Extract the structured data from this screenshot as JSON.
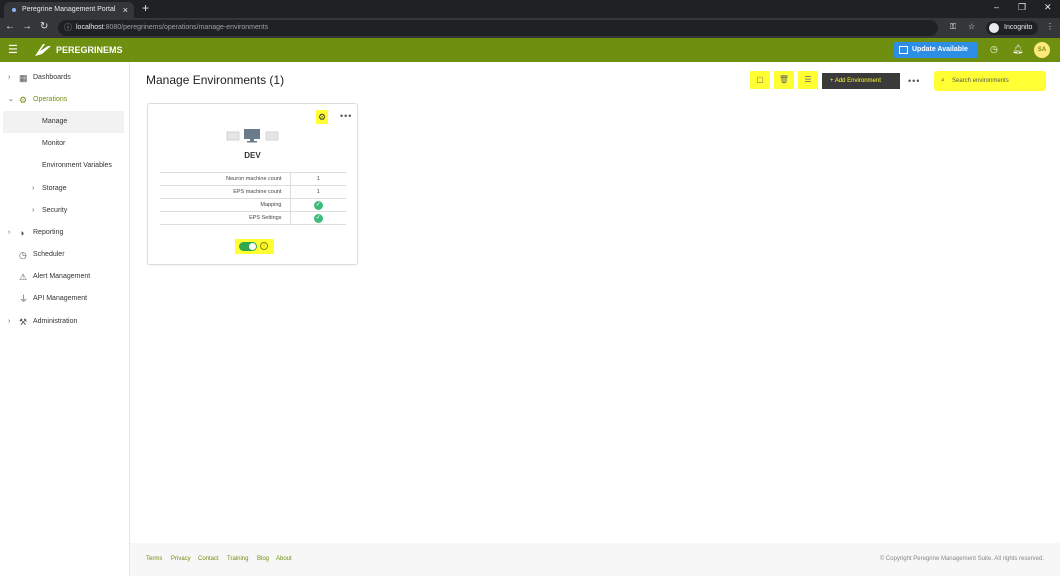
{
  "browser": {
    "tab_title": "Peregrine Management Portal",
    "tab_close": "×",
    "new_tab": "+",
    "url_host": "localhost",
    "url_rest": ":8080/peregrinems/operations/manage-environments",
    "incognito_label": "Incognito",
    "window_controls": [
      "–",
      "❐",
      "✕"
    ]
  },
  "header": {
    "logo_text": "PEREGRINEMS",
    "update_label": "Update Available",
    "avatar_initials": "SA"
  },
  "sidebar": {
    "items": [
      {
        "label": "Dashboards",
        "icon": "dashboard-icon"
      },
      {
        "label": "Operations",
        "icon": "gear-icon"
      },
      {
        "label": "Manage"
      },
      {
        "label": "Monitor"
      },
      {
        "label": "Environment Variables"
      },
      {
        "label": "Storage"
      },
      {
        "label": "Security"
      },
      {
        "label": "Reporting",
        "icon": "reporting-icon"
      },
      {
        "label": "Scheduler",
        "icon": "clock-icon"
      },
      {
        "label": "Alert Management",
        "icon": "alert-icon"
      },
      {
        "label": "API Management",
        "icon": "plug-icon"
      },
      {
        "label": "Administration",
        "icon": "wrench-icon"
      }
    ]
  },
  "main": {
    "title": "Manage Environments (1)",
    "add_environment_label": "+ Add Environment",
    "search_placeholder": "Search environments"
  },
  "environment_card": {
    "name": "DEV",
    "rows": [
      {
        "label": "Neuron machine count",
        "value": "1"
      },
      {
        "label": "EPS machine count",
        "value": "1"
      },
      {
        "label": "Mapping",
        "value": "✓"
      },
      {
        "label": "EPS Settings",
        "value": "✓"
      }
    ],
    "enabled": true
  },
  "footer": {
    "links": [
      "Terms",
      "Privacy",
      "Contact",
      "Training",
      "Blog",
      "About"
    ],
    "copyright": "© Copyright Peregrine Management Suite. All rights reserved."
  },
  "colors": {
    "accent": "#6f8f10",
    "highlight": "#ffff33",
    "update_button": "#2e8ee6",
    "check": "#3dbb7c"
  }
}
